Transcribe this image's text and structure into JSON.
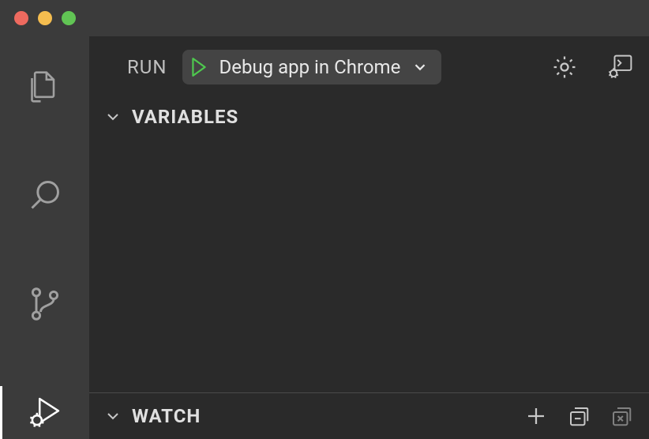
{
  "header": {
    "run_label": "RUN",
    "config_name": "Debug app in Chrome"
  },
  "sections": {
    "variables": {
      "title": "VARIABLES",
      "expanded": true
    },
    "watch": {
      "title": "WATCH",
      "expanded": true
    }
  },
  "activity": {
    "active": "run-debug"
  }
}
